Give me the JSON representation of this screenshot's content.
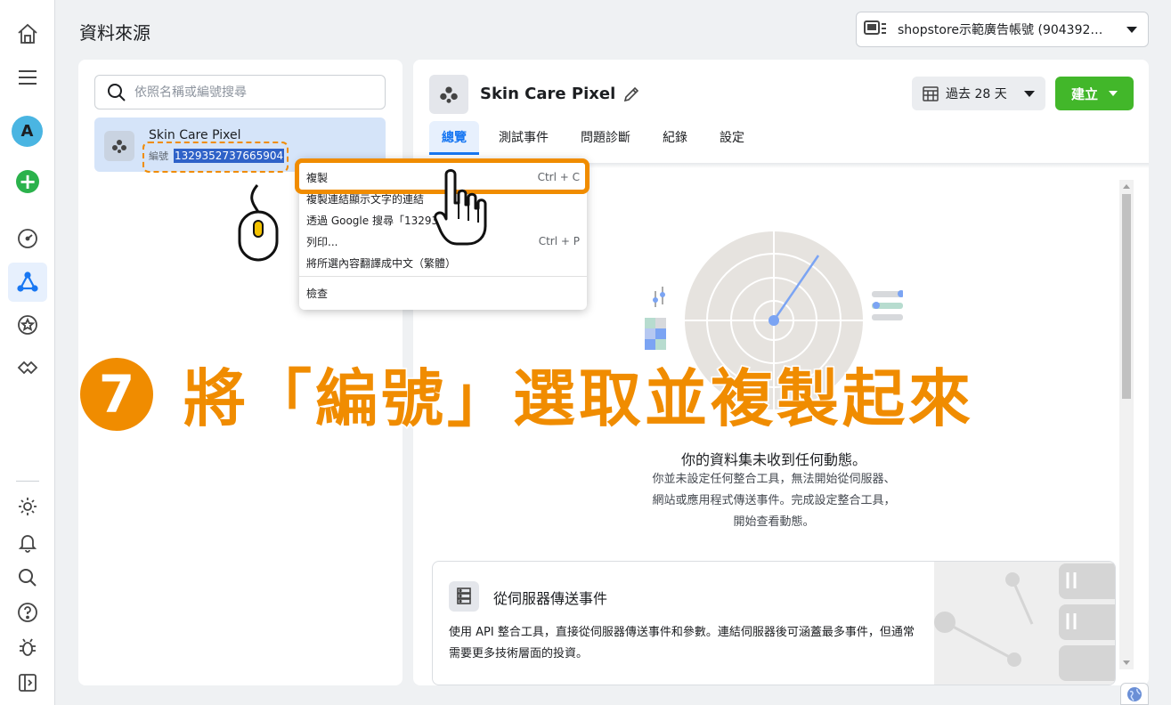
{
  "page": {
    "title": "資料來源"
  },
  "account": {
    "label": "shopstore示範廣告帳號 (904392…"
  },
  "sidebar": {
    "avatar_letter": "A"
  },
  "left_panel": {
    "search_placeholder": "依照名稱或編號搜尋",
    "pixel": {
      "name": "Skin Care Pixel",
      "id_label": "編號",
      "id_value": "1329352737665904"
    }
  },
  "detail": {
    "title": "Skin Care Pixel",
    "date_range": "過去 28 天",
    "create_label": "建立",
    "tabs": [
      "總覽",
      "測試事件",
      "問題診斷",
      "紀錄",
      "設定"
    ],
    "active_tab": 0,
    "empty_title": "你的資料集未收到任何動態。",
    "empty_desc": "你並未設定任何整合工具，無法開始從伺服器、網站或應用程式傳送事件。完成設定整合工具，開始查看動態。",
    "server_card": {
      "title": "從伺服器傳送事件",
      "desc": "使用 API 整合工具，直接從伺服器傳送事件和參數。連結伺服器後可涵蓋最多事件，但通常需要更多技術層面的投資。"
    }
  },
  "context_menu": {
    "items": [
      {
        "label": "複製",
        "shortcut": "Ctrl + C"
      },
      {
        "label": "複製連結顯示文字的連結",
        "shortcut": ""
      },
      {
        "label": "透過 Google 搜尋「13293…904」",
        "shortcut": ""
      },
      {
        "label": "列印...",
        "shortcut": "Ctrl + P"
      },
      {
        "label": "將所選內容翻譯成中文（繁體）",
        "shortcut": ""
      },
      {
        "label": "檢查",
        "shortcut": ""
      }
    ]
  },
  "overlay": {
    "step_number": "7",
    "instruction": "將「編號」選取並複製起來",
    "accent_color": "#f08c00"
  },
  "colors": {
    "brand_blue": "#1877f2",
    "create_green": "#42b72a",
    "selection_blue": "#2f62c8"
  }
}
